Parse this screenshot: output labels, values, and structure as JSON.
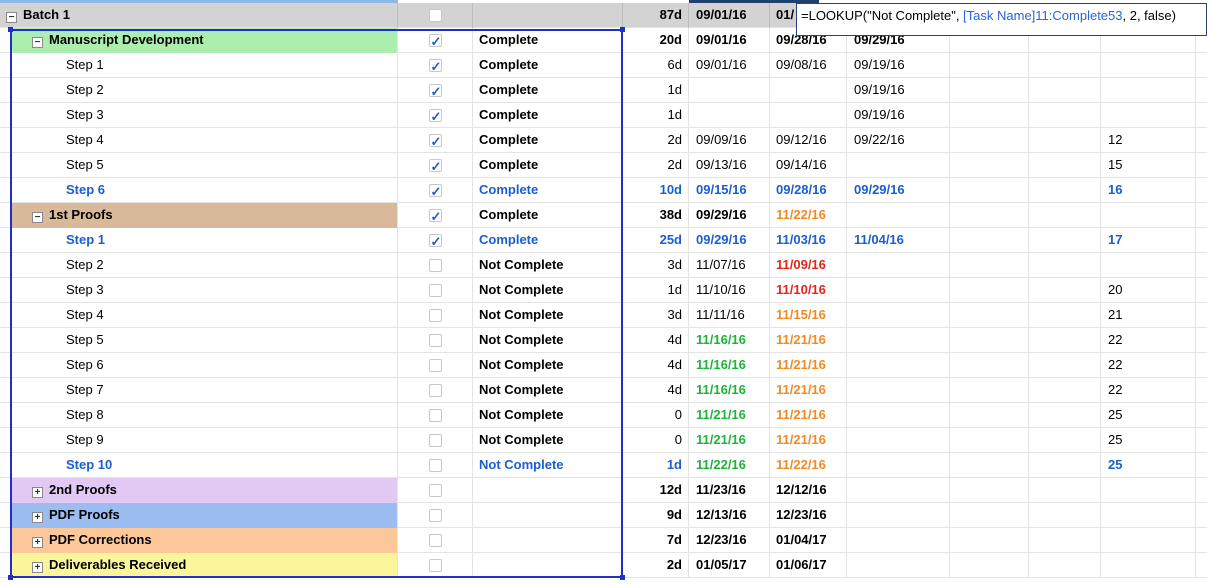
{
  "formula": {
    "prefix": "=LOOKUP(\"Not Complete\", ",
    "ref": "[Task Name]11:Complete53",
    "suffix": ", 2, false)"
  },
  "rows": [
    {
      "name": "Batch 1",
      "level": 0,
      "toggle": "−",
      "bg": "#d3d3d3",
      "checked": false,
      "status": "",
      "duration": "87d",
      "start": "09/01/16",
      "end": "01/",
      "c8": "",
      "c11": "",
      "style": "bold",
      "end_style": "bold"
    },
    {
      "name": "Manuscript Development",
      "level": 1,
      "toggle": "−",
      "bg": "#abeeae",
      "checked": true,
      "status": "Complete",
      "duration": "20d",
      "start": "09/01/16",
      "end": "09/28/16",
      "c8": "09/29/16",
      "c11": "",
      "style": "bold",
      "end_style": "bold"
    },
    {
      "name": "Step 1",
      "level": 2,
      "checked": true,
      "status": "Complete",
      "duration": "6d",
      "start": "09/01/16",
      "end": "09/08/16",
      "c8": "09/19/16",
      "c11": "",
      "style": "",
      "end_style": ""
    },
    {
      "name": "Step 2",
      "level": 2,
      "checked": true,
      "status": "Complete",
      "duration": "1d",
      "start": "",
      "end": "",
      "c8": "09/19/16",
      "c11": "",
      "style": "",
      "end_style": ""
    },
    {
      "name": "Step 3",
      "level": 2,
      "checked": true,
      "status": "Complete",
      "duration": "1d",
      "start": "",
      "end": "",
      "c8": "09/19/16",
      "c11": "",
      "style": "",
      "end_style": ""
    },
    {
      "name": "Step 4",
      "level": 2,
      "checked": true,
      "status": "Complete",
      "duration": "2d",
      "start": "09/09/16",
      "end": "09/12/16",
      "c8": "09/22/16",
      "c11": "12",
      "style": "",
      "end_style": ""
    },
    {
      "name": "Step 5",
      "level": 2,
      "checked": true,
      "status": "Complete",
      "duration": "2d",
      "start": "09/13/16",
      "end": "09/14/16",
      "c8": "",
      "c11": "15",
      "style": "",
      "end_style": ""
    },
    {
      "name": "Step 6",
      "level": 2,
      "checked": true,
      "status": "Complete",
      "duration": "10d",
      "start": "09/15/16",
      "end": "09/28/16",
      "c8": "09/29/16",
      "c11": "16",
      "style": "blue",
      "end_style": "blue"
    },
    {
      "name": "1st Proofs",
      "level": 1,
      "toggle": "−",
      "bg": "#d8b99a",
      "checked": true,
      "status": "Complete",
      "duration": "38d",
      "start": "09/29/16",
      "end": "11/22/16",
      "c8": "",
      "c11": "",
      "style": "bold",
      "end_style": "orange"
    },
    {
      "name": "Step 1",
      "level": 2,
      "checked": true,
      "status": "Complete",
      "duration": "25d",
      "start": "09/29/16",
      "end": "11/03/16",
      "c8": "11/04/16",
      "c11": "17",
      "style": "blue",
      "end_style": "blue"
    },
    {
      "name": "Step 2",
      "level": 2,
      "checked": false,
      "status": "Not Complete",
      "duration": "3d",
      "start": "11/07/16",
      "end": "11/09/16",
      "c8": "",
      "c11": "",
      "style": "",
      "end_style": "red"
    },
    {
      "name": "Step 3",
      "level": 2,
      "checked": false,
      "status": "Not Complete",
      "duration": "1d",
      "start": "11/10/16",
      "end": "11/10/16",
      "c8": "",
      "c11": "20",
      "style": "",
      "end_style": "red"
    },
    {
      "name": "Step 4",
      "level": 2,
      "checked": false,
      "status": "Not Complete",
      "duration": "3d",
      "start": "11/11/16",
      "end": "11/15/16",
      "c8": "",
      "c11": "21",
      "style": "",
      "end_style": "orange"
    },
    {
      "name": "Step 5",
      "level": 2,
      "checked": false,
      "status": "Not Complete",
      "duration": "4d",
      "start": "11/16/16",
      "end": "11/21/16",
      "c8": "",
      "c11": "22",
      "style": "",
      "start_style": "green",
      "end_style": "orange"
    },
    {
      "name": "Step 6",
      "level": 2,
      "checked": false,
      "status": "Not Complete",
      "duration": "4d",
      "start": "11/16/16",
      "end": "11/21/16",
      "c8": "",
      "c11": "22",
      "style": "",
      "start_style": "green",
      "end_style": "orange"
    },
    {
      "name": "Step 7",
      "level": 2,
      "checked": false,
      "status": "Not Complete",
      "duration": "4d",
      "start": "11/16/16",
      "end": "11/21/16",
      "c8": "",
      "c11": "22",
      "style": "",
      "start_style": "green",
      "end_style": "orange"
    },
    {
      "name": "Step 8",
      "level": 2,
      "checked": false,
      "status": "Not Complete",
      "duration": "0",
      "start": "11/21/16",
      "end": "11/21/16",
      "c8": "",
      "c11": "25",
      "style": "",
      "start_style": "green",
      "end_style": "orange"
    },
    {
      "name": "Step 9",
      "level": 2,
      "checked": false,
      "status": "Not Complete",
      "duration": "0",
      "start": "11/21/16",
      "end": "11/21/16",
      "c8": "",
      "c11": "25",
      "style": "",
      "start_style": "green",
      "end_style": "orange"
    },
    {
      "name": "Step 10",
      "level": 2,
      "checked": false,
      "status": "Not Complete",
      "duration": "1d",
      "start": "11/22/16",
      "end": "11/22/16",
      "c8": "",
      "c11": "25",
      "style": "blue",
      "start_style": "green",
      "end_style": "orange"
    },
    {
      "name": "2nd Proofs",
      "level": 1,
      "toggle": "+",
      "bg": "#e2c9f4",
      "checked": false,
      "status": "",
      "duration": "12d",
      "start": "11/23/16",
      "end": "12/12/16",
      "c8": "",
      "c11": "",
      "style": "bold",
      "end_style": "bold"
    },
    {
      "name": "PDF Proofs",
      "level": 1,
      "toggle": "+",
      "bg": "#9cbdf2",
      "checked": false,
      "status": "",
      "duration": "9d",
      "start": "12/13/16",
      "end": "12/23/16",
      "c8": "",
      "c11": "",
      "style": "bold",
      "end_style": "bold"
    },
    {
      "name": "PDF Corrections",
      "level": 1,
      "toggle": "+",
      "bg": "#fcc899",
      "checked": false,
      "status": "",
      "duration": "7d",
      "start": "12/23/16",
      "end": "01/04/17",
      "c8": "",
      "c11": "",
      "style": "bold",
      "end_style": "bold"
    },
    {
      "name": "Deliverables Received",
      "level": 1,
      "toggle": "+",
      "bg": "#fbf59b",
      "checked": false,
      "status": "",
      "duration": "2d",
      "start": "01/05/17",
      "end": "01/06/17",
      "c8": "",
      "c11": "",
      "style": "bold",
      "end_style": "bold"
    }
  ]
}
